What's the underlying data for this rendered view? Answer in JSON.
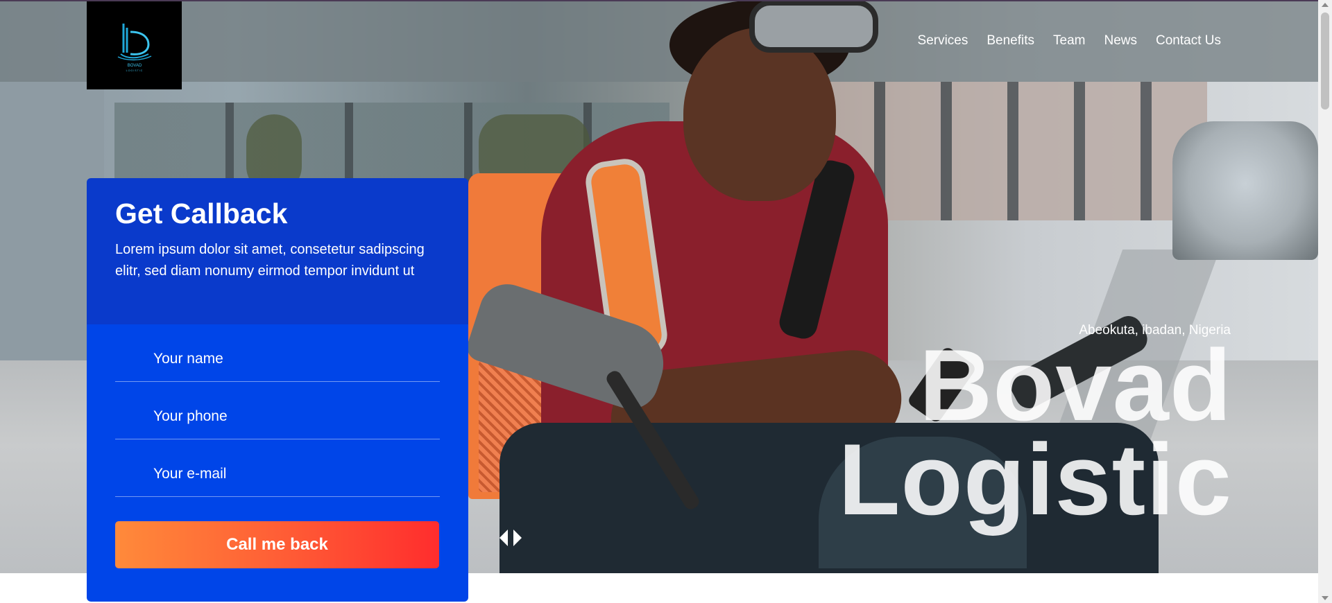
{
  "brand": {
    "logo_text": "BOVAD",
    "logo_subtext": "LOGISTIC",
    "accent_color": "#0045e8",
    "accent_dark": "#0a3acb",
    "button_gradient": [
      "#ff8a3a",
      "#ff2d2d"
    ]
  },
  "nav": {
    "items": [
      {
        "label": "Services"
      },
      {
        "label": "Benefits"
      },
      {
        "label": "Team"
      },
      {
        "label": "News"
      },
      {
        "label": "Contact Us"
      }
    ]
  },
  "callback": {
    "title": "Get Callback",
    "description": "Lorem ipsum dolor sit amet, consetetur sadipscing elitr, sed diam nonumy eirmod tempor invidunt ut",
    "fields": {
      "name_placeholder": "Your name",
      "phone_placeholder": "Your phone",
      "email_placeholder": "Your e-mail"
    },
    "submit_label": "Call me back"
  },
  "hero": {
    "locations": "Abeokuta, ibadan, Nigeria",
    "title_line1": "Bovad",
    "title_line2": "Logistic"
  },
  "icons": {
    "slider_prev": "chevron-left-icon",
    "slider_next": "chevron-right-icon"
  }
}
